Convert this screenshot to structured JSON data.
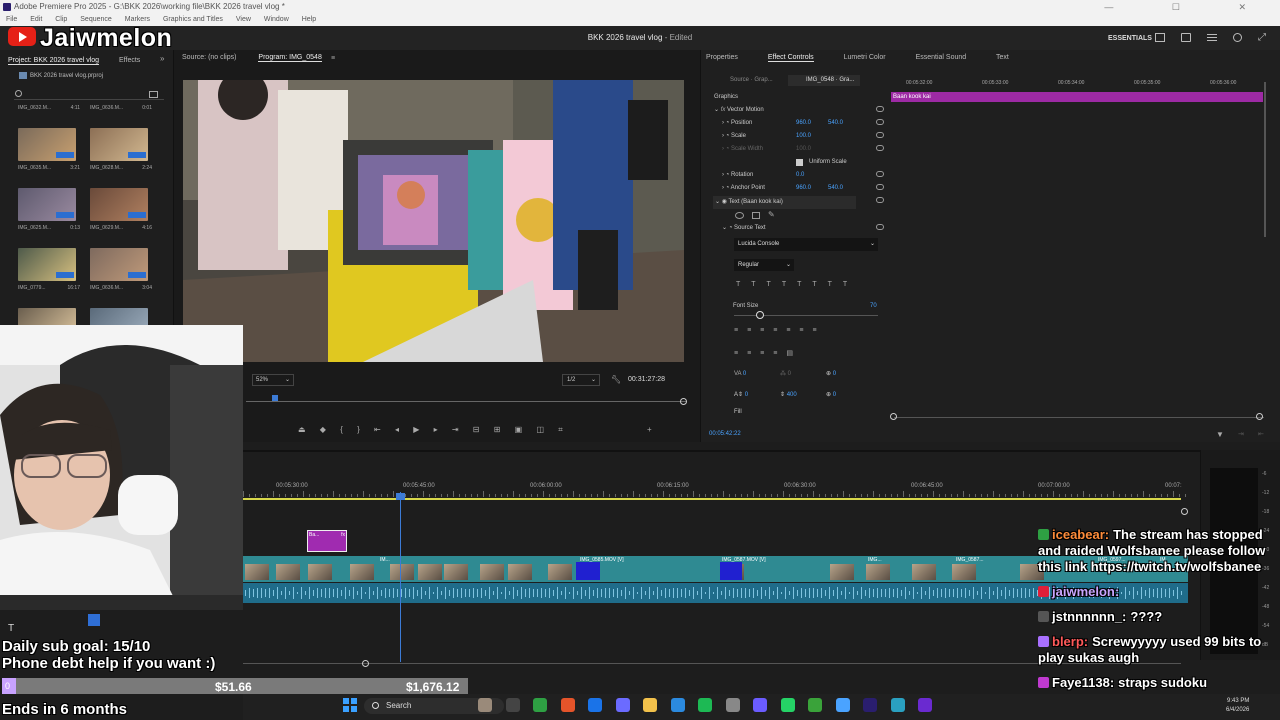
{
  "window": {
    "title": "Adobe Premiere Pro 2025 - G:\\BKK 2026\\working file\\BKK 2026 travel vlog *",
    "menus": [
      "File",
      "Edit",
      "Clip",
      "Sequence",
      "Markers",
      "Graphics and Titles",
      "View",
      "Window",
      "Help"
    ],
    "project_title": "BKK 2026 travel vlog",
    "project_status": "- Edited",
    "workspace": "ESSENTIALS"
  },
  "brand": {
    "name": "Jaiwmelon"
  },
  "project_panel": {
    "tabs": [
      "Project: BKK 2026 travel vlog",
      "Effects"
    ],
    "path": "BKK 2026 travel vlog.prproj",
    "items": [
      {
        "name": "IMG_0632.M...",
        "duration": "4:11"
      },
      {
        "name": "IMG_0636.M...",
        "duration": "0:01"
      },
      {
        "name": "IMG_0635.M...",
        "duration": "3:21"
      },
      {
        "name": "IMG_0628.M...",
        "duration": "2:24"
      },
      {
        "name": "IMG_0625.M...",
        "duration": "0:13"
      },
      {
        "name": "IMG_0629.M...",
        "duration": "4:16"
      },
      {
        "name": "IMG_0779...",
        "duration": "16:17"
      },
      {
        "name": "IMG_0636.M...",
        "duration": "3:04"
      }
    ]
  },
  "monitor": {
    "source_tab": "Source: (no clips)",
    "program_tab": "Program: IMG_0548",
    "zoom": "52%",
    "resolution": "1/2",
    "timecode": "00:31:27:28",
    "playhead_fraction": 0.06
  },
  "effect_controls": {
    "tabs": [
      "Properties",
      "Effect Controls",
      "Lumetri Color",
      "Essential Sound",
      "Text"
    ],
    "source_sel": "Source · Grap...",
    "clip_sel": "IMG_0548 · Gra...",
    "section": "Graphics",
    "vector_motion": "Vector Motion",
    "position_label": "Position",
    "position_x": "960.0",
    "position_y": "540.0",
    "scale_label": "Scale",
    "scale_val": "100.0",
    "scale_width_label": "Scale Width",
    "scale_width_val": "100.0",
    "uniform_scale": "Uniform Scale",
    "rotation_label": "Rotation",
    "rotation_val": "0.0",
    "anchor_label": "Anchor Point",
    "anchor_x": "960.0",
    "anchor_y": "540.0",
    "text_layer": "Text (Baan kook kai)",
    "source_text": "Source Text",
    "font": "Lucida Console",
    "font_style": "Regular",
    "font_size_label": "Font Size",
    "font_size": "70",
    "tracking": "0",
    "leading": "400",
    "kerning": "0",
    "tsume": "0",
    "baseline": "0",
    "kern2": "0",
    "fill_label": "Fill",
    "time_ruler": [
      "00:05:32:00",
      "00:05:33:00",
      "00:05:34:00",
      "00:05:35:00",
      "00:05:36:00"
    ],
    "clip_label": "Baan kook kai",
    "current_time": "00:05:42:22"
  },
  "timeline": {
    "ruler": [
      "00:05:30:00",
      "00:05:45:00",
      "00:06:00:00",
      "00:06:15:00",
      "00:06:30:00",
      "00:06:45:00",
      "00:07:00:00",
      "00:07:"
    ],
    "title_clip": "Ba...",
    "clips": [
      "IM...",
      "IMG_0585.MOV [V]",
      "IMG_0587.MOV [V]",
      "IMG...",
      "IMG_0587...",
      "IMG_0597...",
      "IM"
    ],
    "meter_db": [
      "-6",
      "-12",
      "-18",
      "-24",
      "-30",
      "-36",
      "-42",
      "-48",
      "-54",
      "dB"
    ]
  },
  "overlay": {
    "goal_line1": "Daily sub goal: 15/10",
    "goal_line2": "Phone debt help if you want :)",
    "goal_start": "0",
    "goal_current": "$51.66",
    "goal_target": "$1,676.12",
    "goal_fraction": 0.031,
    "ends": "Ends in 6 months"
  },
  "chat": [
    {
      "name": "iceabear",
      "color": "#ff8c3a",
      "badge": "#2ea043",
      "text": "The stream has stopped and raided Wolfsbanee please follow this link https://twitch.tv/wolfsbanee"
    },
    {
      "name": "jaiwmelon",
      "color": "#c9a6ff",
      "badge": "#e01f3a",
      "text": ""
    },
    {
      "name": "jstnnnnnn_",
      "color": "#ffffff",
      "badge": "#555555",
      "text": "????"
    },
    {
      "name": "blerp",
      "color": "#ff5a5a",
      "badge": "#a970ff",
      "text": "Screwyyyyy used 99 bits to play sukas augh"
    },
    {
      "name": "Faye1138",
      "color": "#ffffff",
      "badge": "#c03ad0",
      "text": "straps sudoku"
    }
  ],
  "taskbar": {
    "search": "Search",
    "clock_time": "9:43 PM",
    "clock_date": "6/4/2026"
  },
  "colors": {
    "accent": "#4aa3ff",
    "video_track": "#2f8a92",
    "audio_track": "#1f6c8a",
    "graphic_clip": "#a02bb0",
    "playhead": "#3c7bd6"
  }
}
